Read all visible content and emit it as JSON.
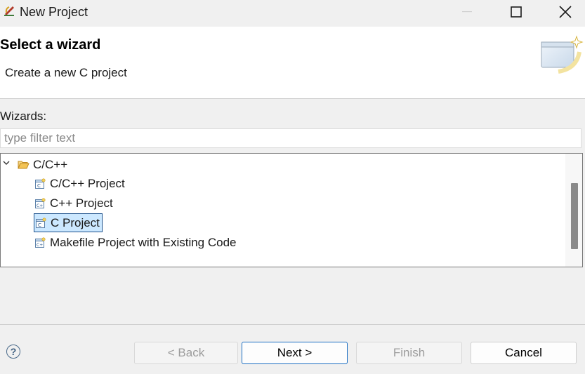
{
  "window": {
    "title": "New Project",
    "controls": [
      "minimize",
      "maximize",
      "close"
    ]
  },
  "header": {
    "title": "Select a wizard",
    "description": "Create a new C project"
  },
  "wizards": {
    "label": "Wizards:",
    "filter_placeholder": "type filter text",
    "filter_value": "",
    "tree": {
      "category": {
        "label": "C/C++",
        "expanded": true,
        "icon": "folder-open-icon"
      },
      "items": [
        {
          "label": "C/C++ Project",
          "icon": "c-project-icon",
          "selected": false
        },
        {
          "label": "C++ Project",
          "icon": "cpp-project-icon",
          "selected": false
        },
        {
          "label": "C Project",
          "icon": "c-project-icon",
          "selected": true
        },
        {
          "label": "Makefile Project with Existing Code",
          "icon": "cpp-project-icon",
          "selected": false
        }
      ]
    }
  },
  "buttons": {
    "back": {
      "label": "< Back",
      "enabled": false
    },
    "next": {
      "label": "Next >",
      "enabled": true,
      "default": true
    },
    "finish": {
      "label": "Finish",
      "enabled": false
    },
    "cancel": {
      "label": "Cancel",
      "enabled": true
    }
  },
  "colors": {
    "selection_bg": "#cce8ff",
    "selection_border": "#1a4f8a",
    "default_button_border": "#1b6ec2",
    "folder": "#e8a93a"
  }
}
